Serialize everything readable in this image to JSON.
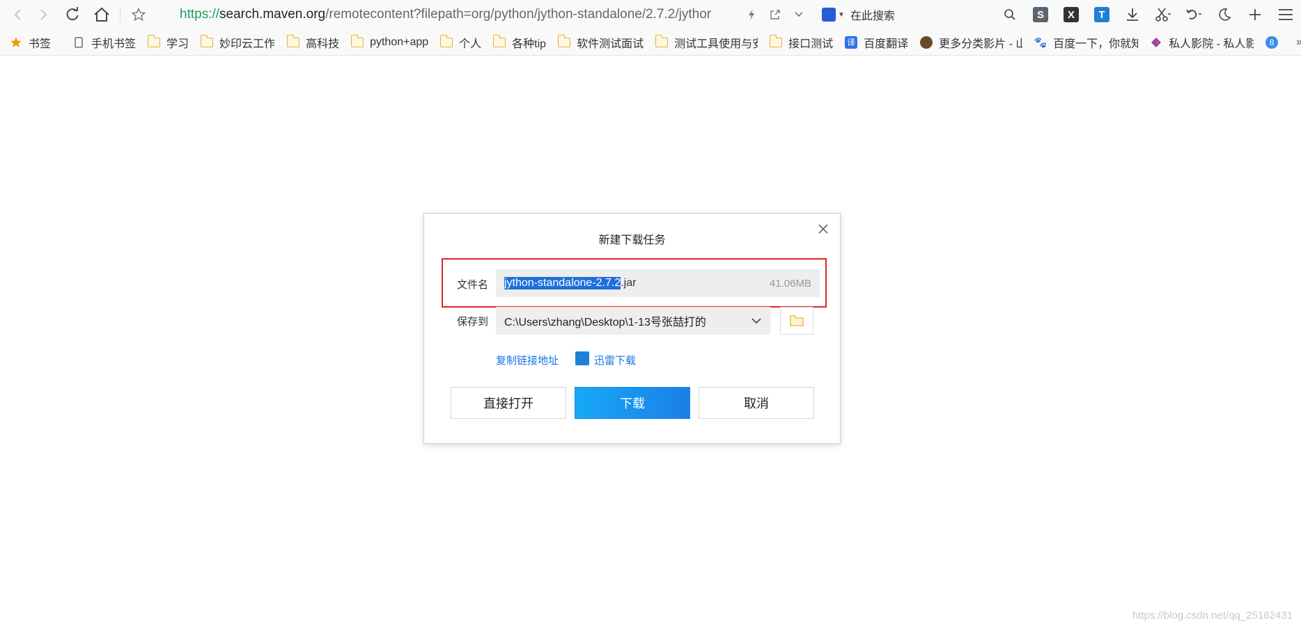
{
  "browser": {
    "url": {
      "scheme": "https://",
      "host": "search.maven.org",
      "rest": "/remotecontent?filepath=org/python/jython-standalone/2.7.2/jythor"
    },
    "search_placeholder": "在此搜索"
  },
  "bookmarks": {
    "star_label": "书签",
    "items": [
      {
        "label": "手机书签",
        "icon": "phone-icon"
      },
      {
        "label": "学习",
        "icon": "folder-icon"
      },
      {
        "label": "妙印云工作",
        "icon": "folder-icon"
      },
      {
        "label": "高科技",
        "icon": "folder-icon"
      },
      {
        "label": "python+app",
        "icon": "folder-icon"
      },
      {
        "label": "个人",
        "icon": "folder-icon"
      },
      {
        "label": "各种tip",
        "icon": "folder-icon"
      },
      {
        "label": "软件测试面试",
        "icon": "folder-icon"
      },
      {
        "label": "测试工具使用与安",
        "icon": "folder-icon"
      },
      {
        "label": "接口测试",
        "icon": "folder-icon"
      },
      {
        "label": "百度翻译",
        "icon": "translate-icon"
      },
      {
        "label": "更多分类影片 - 山",
        "icon": "film-icon"
      },
      {
        "label": "百度一下，你就知",
        "icon": "baidu-icon"
      },
      {
        "label": "私人影院 - 私人影",
        "icon": "cinema-icon"
      }
    ]
  },
  "dialog": {
    "title": "新建下载任务",
    "filename_label": "文件名",
    "filename_selected": "jython-standalone-2.7.2",
    "filename_ext": ".jar",
    "file_size": "41.06MB",
    "save_label": "保存到",
    "save_path": "C:\\Users\\zhang\\Desktop\\1-13号张喆打的",
    "copy_link": "复制链接地址",
    "thunder": "迅雷下载",
    "btn_open": "直接打开",
    "btn_download": "下载",
    "btn_cancel": "取消"
  },
  "watermark": "https://blog.csdn.net/qq_25162431",
  "colors": {
    "highlight_border": "#e02424",
    "primary_button": "#1b7fe6",
    "link": "#1a73e8",
    "selection": "#1f6fdc"
  }
}
